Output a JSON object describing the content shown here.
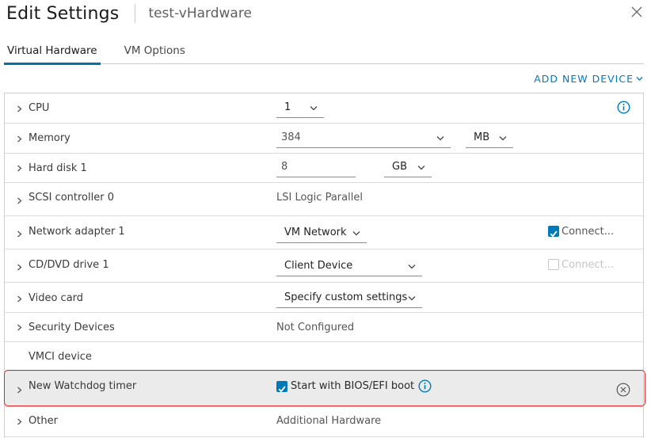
{
  "header": {
    "title": "Edit Settings",
    "subtitle": "test-vHardware"
  },
  "tabs": [
    {
      "label": "Virtual Hardware",
      "active": true
    },
    {
      "label": "VM Options",
      "active": false
    }
  ],
  "add_device_label": "ADD NEW DEVICE",
  "rows": {
    "cpu": {
      "label": "CPU",
      "select_value": "1"
    },
    "memory": {
      "label": "Memory",
      "value": "384",
      "unit": "MB"
    },
    "hard_disk": {
      "label": "Hard disk 1",
      "value": "8",
      "unit": "GB"
    },
    "scsi": {
      "label": "SCSI controller 0",
      "value": "LSI Logic Parallel"
    },
    "network": {
      "label": "Network adapter 1",
      "select_value": "VM Network",
      "connect_label": "Connect...",
      "connected": true
    },
    "cddvd": {
      "label": "CD/DVD drive 1",
      "select_value": "Client Device",
      "connect_label": "Connect...",
      "connected": false
    },
    "video": {
      "label": "Video card",
      "select_value": "Specify custom settings"
    },
    "security": {
      "label": "Security Devices",
      "value": "Not Configured"
    },
    "vmci": {
      "label": "VMCI device"
    },
    "watchdog": {
      "label": "New Watchdog timer",
      "checkbox_label": "Start with BIOS/EFI boot",
      "checked": true
    },
    "other": {
      "label": "Other",
      "value": "Additional Hardware"
    }
  },
  "colors": {
    "accent": "#0079b8",
    "highlight_border": "#e0262b",
    "row_highlight": "#ebebeb"
  }
}
